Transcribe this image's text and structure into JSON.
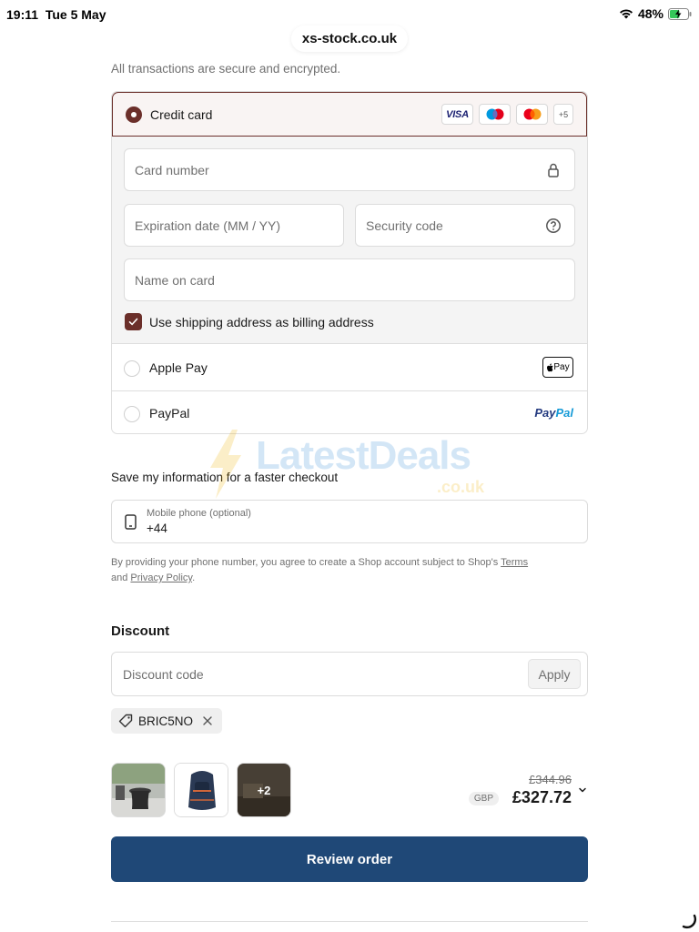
{
  "status_bar": {
    "time": "19:11",
    "date": "Tue 5 May",
    "battery": "48%"
  },
  "browser": {
    "url": "xs-stock.co.uk"
  },
  "payment": {
    "secure_note": "All transactions are secure and encrypted.",
    "credit_card": {
      "label": "Credit card",
      "logos": [
        "VISA",
        "Maestro",
        "Mastercard"
      ],
      "more_count": "+5",
      "card_number_placeholder": "Card number",
      "expiration_placeholder": "Expiration date (MM / YY)",
      "security_code_placeholder": "Security code",
      "name_placeholder": "Name on card",
      "billing_checkbox_label": "Use shipping address as billing address",
      "billing_checked": true
    },
    "apple_pay": {
      "label": "Apple Pay",
      "badge": "Pay"
    },
    "paypal": {
      "label": "PayPal",
      "logo_part1": "Pay",
      "logo_part2": "Pal"
    }
  },
  "watermark": {
    "text": "LatestDeals",
    "sub": ".co.uk"
  },
  "save_info": {
    "title": "Save my information for a faster checkout",
    "phone_label": "Mobile phone (optional)",
    "phone_value": "+44",
    "legal_prefix": "By providing your phone number, you agree to create a Shop account subject to Shop's",
    "terms_link": "Terms",
    "legal_and": "and",
    "privacy_link": "Privacy Policy",
    "legal_suffix": "."
  },
  "discount": {
    "title": "Discount",
    "placeholder": "Discount code",
    "apply_label": "Apply",
    "applied_code": "BRIC5NO"
  },
  "order_summary": {
    "more_items": "+2",
    "original_price": "£344.96",
    "currency": "GBP",
    "total_price": "£327.72"
  },
  "review_button": "Review order",
  "colors": {
    "accent": "#6b2f2a",
    "primary_button": "#1f4877"
  }
}
